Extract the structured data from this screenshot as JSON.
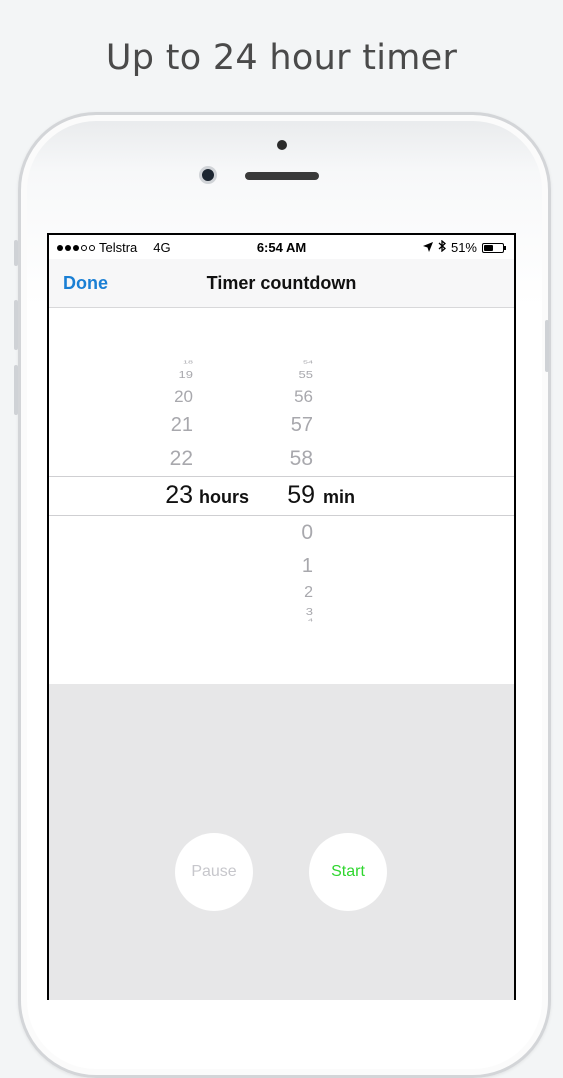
{
  "headline": "Up to 24 hour timer",
  "status_bar": {
    "carrier": "Telstra",
    "network": "4G",
    "time": "6:54 AM",
    "battery": "51%",
    "battery_level": 0.51,
    "icons": [
      "signal-dots-icon",
      "location-arrow-icon",
      "bluetooth-icon",
      "battery-icon"
    ]
  },
  "nav": {
    "done_label": "Done",
    "title": "Timer countdown"
  },
  "picker": {
    "hours": {
      "above": [
        "18",
        "19",
        "20",
        "21",
        "22"
      ],
      "selected": "23",
      "below": [],
      "unit": "hours"
    },
    "minutes": {
      "above": [
        "54",
        "55",
        "56",
        "57",
        "58"
      ],
      "selected": "59",
      "below": [
        "0",
        "1",
        "2",
        "3",
        "4"
      ],
      "unit": "min"
    }
  },
  "controls": {
    "pause_label": "Pause",
    "start_label": "Start"
  },
  "colors": {
    "accent": "#1a7fd4",
    "start": "#2fd62f",
    "disabled": "#c7c7cc",
    "controls_bg": "#e7e7e8"
  }
}
